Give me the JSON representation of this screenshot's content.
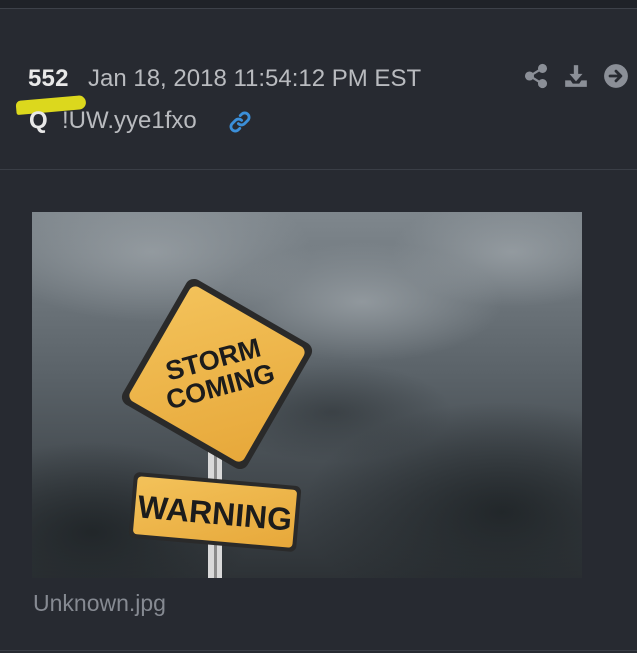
{
  "post": {
    "number": "552",
    "date": "Jan 18, 2018 11:54:12 PM EST",
    "author": "Q",
    "tripcode": "!UW.yye1fxo",
    "highlight_color": "#e6e21c",
    "link_color": "#3b8fd9"
  },
  "actions": {
    "icons": [
      "share-icon",
      "download-icon",
      "arrow-right-circle-icon"
    ]
  },
  "attachment": {
    "filename": "Unknown.jpg",
    "sign_line1": "STORM",
    "sign_line2": "COMING",
    "sign_warning": "WARNING"
  }
}
